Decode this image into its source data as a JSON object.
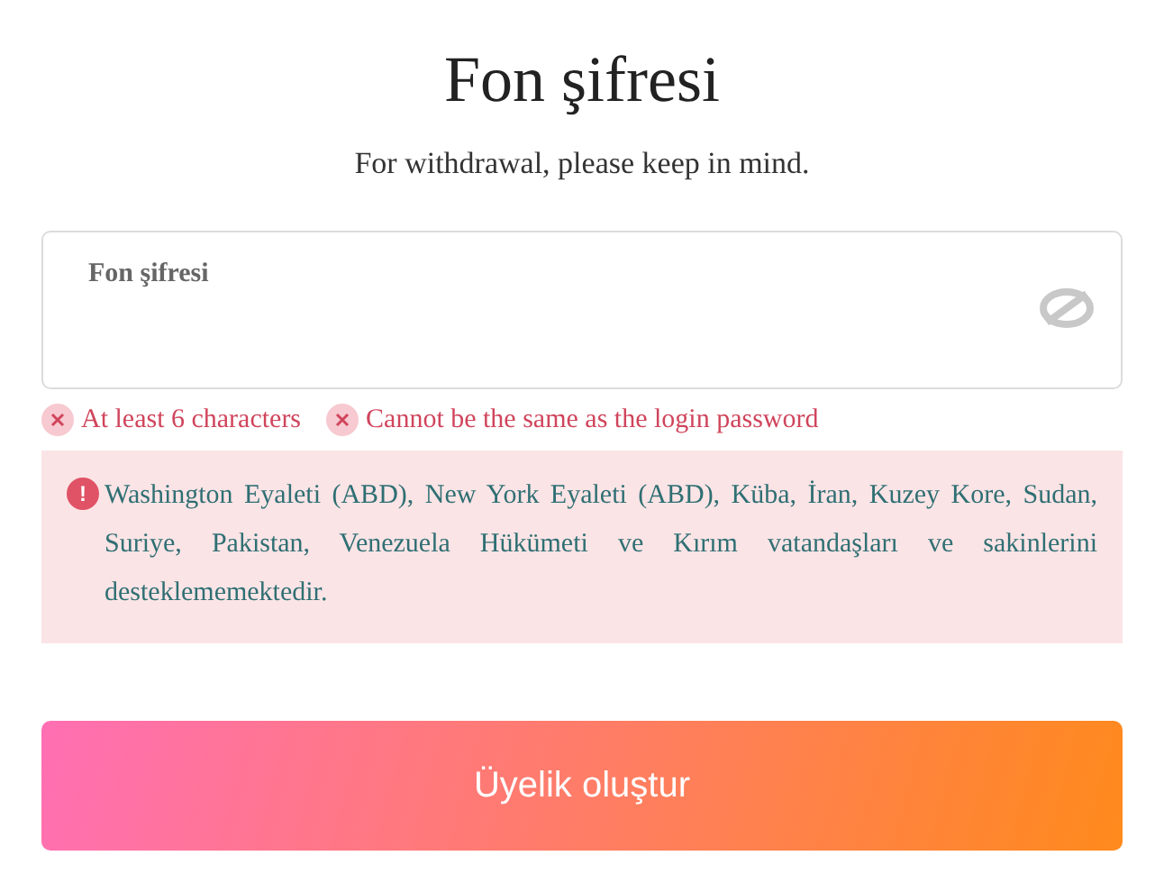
{
  "title": "Fon şifresi",
  "subtitle": "For withdrawal, please keep in mind.",
  "field": {
    "placeholder": "Fon şifresi",
    "visible": false
  },
  "rules": [
    {
      "text": "At least 6 characters",
      "met": false
    },
    {
      "text": "Cannot be the same as the login password",
      "met": false
    }
  ],
  "notice": {
    "icon": "!",
    "text": "Washington Eyaleti (ABD), New York Eyaleti (ABD), Küba, İran, Kuzey Kore, Sudan, Suriye, Pakistan, Venezuela Hükümeti ve Kırım vatandaşları ve sakinlerini desteklememektedir."
  },
  "submit": "Üyelik oluştur"
}
